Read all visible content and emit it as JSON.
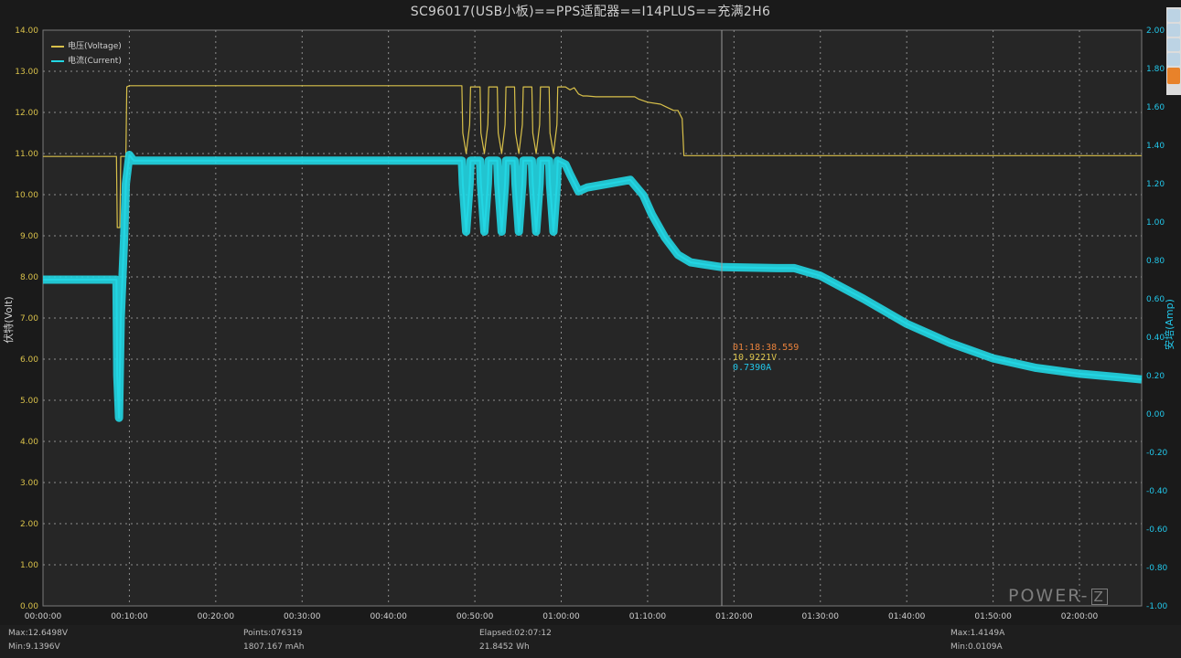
{
  "title": "SC96017(USB小板)==PPS适配器==I14PLUS==充满2H6",
  "colors": {
    "voltage": "#d8c04a",
    "current": "#22d6e3",
    "cursor_time": "#e9823c",
    "cursor_v": "#d8c04a",
    "cursor_a": "#22c7ea",
    "grid": "#8d8d8d",
    "bg": "#1a1a1a"
  },
  "legend": {
    "voltage": "电压(Voltage)",
    "current": "电流(Current)"
  },
  "cursor": {
    "time": "01:18:38.559",
    "voltage": "10.9221V",
    "current": "0.7390A"
  },
  "footer": {
    "max_v": "Max:12.6498V",
    "min_v": "Min:9.1396V",
    "points": "Points:076319",
    "mah": "1807.167 mAh",
    "elapsed": "Elapsed:02:07:12",
    "wh": "21.8452 Wh",
    "max_a": "Max:1.4149A",
    "min_a": "Min:0.0109A"
  },
  "logo": {
    "text": "POWER-",
    "box": "Z"
  },
  "chart_data": {
    "type": "line",
    "ylabel": "伏特(Volt)",
    "y2label": "安培(Amp)",
    "ylim": [
      0,
      14
    ],
    "y2lim": [
      -1.0,
      2.0
    ],
    "x_tick_labels": [
      "00:00:00",
      "00:10:00",
      "00:20:00",
      "00:30:00",
      "00:40:00",
      "00:50:00",
      "01:00:00",
      "01:10:00",
      "01:20:00",
      "01:30:00",
      "01:40:00",
      "01:50:00",
      "02:00:00"
    ],
    "y_tick_labels": [
      "0.00",
      "1.00",
      "2.00",
      "3.00",
      "4.00",
      "5.00",
      "6.00",
      "7.00",
      "8.00",
      "9.00",
      "10.00",
      "11.00",
      "12.00",
      "13.00",
      "14.00"
    ],
    "y2_tick_labels": [
      "-1.00",
      "-0.80",
      "-0.60",
      "-0.40",
      "-0.20",
      "0.00",
      "0.20",
      "0.40",
      "0.60",
      "0.80",
      "1.00",
      "1.20",
      "1.40",
      "1.60",
      "1.80",
      "2.00"
    ],
    "x_unit": "minutes",
    "xlim": [
      0,
      127.2
    ],
    "series": [
      {
        "name": "电压(Voltage)",
        "axis": "left",
        "x": [
          0,
          8.5,
          8.6,
          8.9,
          9.0,
          9.6,
          9.7,
          10.0,
          48.5,
          48.6,
          49.0,
          49.4,
          49.5,
          50.6,
          50.7,
          51.1,
          51.5,
          51.6,
          52.6,
          52.7,
          53.1,
          53.5,
          53.6,
          54.6,
          54.7,
          55.1,
          55.5,
          55.6,
          56.6,
          56.7,
          57.1,
          57.5,
          57.6,
          58.6,
          58.7,
          59.1,
          59.5,
          59.6,
          60.5,
          61.0,
          61.5,
          62.0,
          62.5,
          63.0,
          64.0,
          68.5,
          69.0,
          70.0,
          71.5,
          72.0,
          73.0,
          73.5,
          74.0,
          74.2,
          127.2
        ],
        "y": [
          10.93,
          10.93,
          9.2,
          9.2,
          10.93,
          10.93,
          12.62,
          12.65,
          12.65,
          11.5,
          11.0,
          11.7,
          12.62,
          12.62,
          11.5,
          11.0,
          11.7,
          12.62,
          12.62,
          11.5,
          11.0,
          11.7,
          12.62,
          12.62,
          11.5,
          11.0,
          11.7,
          12.62,
          12.62,
          11.5,
          11.0,
          11.7,
          12.62,
          12.62,
          11.5,
          11.0,
          11.7,
          12.62,
          12.62,
          12.55,
          12.6,
          12.45,
          12.4,
          12.4,
          12.38,
          12.38,
          12.32,
          12.25,
          12.2,
          12.15,
          12.05,
          12.05,
          11.85,
          10.95,
          10.95
        ]
      },
      {
        "name": "电流(Current)",
        "axis": "right",
        "x": [
          0,
          8.5,
          8.6,
          8.8,
          9.0,
          9.4,
          9.6,
          10.0,
          10.5,
          48.5,
          48.6,
          49.0,
          49.4,
          49.5,
          50.6,
          50.7,
          51.1,
          51.5,
          51.6,
          52.6,
          52.7,
          53.1,
          53.5,
          53.6,
          54.6,
          54.7,
          55.1,
          55.5,
          55.6,
          56.6,
          56.7,
          57.1,
          57.5,
          57.6,
          58.6,
          58.7,
          59.1,
          59.5,
          59.6,
          60.5,
          61.0,
          62.0,
          63.0,
          68.0,
          69.5,
          70.5,
          72.0,
          73.5,
          75.0,
          78.6,
          85.0,
          87.0,
          90.0,
          95.0,
          100.0,
          105.0,
          110.0,
          115.0,
          120.0,
          125.0,
          127.2
        ],
        "y": [
          0.7,
          0.7,
          0.2,
          -0.02,
          0.5,
          0.93,
          1.2,
          1.35,
          1.32,
          1.32,
          1.2,
          0.95,
          1.2,
          1.32,
          1.32,
          1.2,
          0.95,
          1.2,
          1.32,
          1.32,
          1.2,
          0.95,
          1.2,
          1.32,
          1.32,
          1.2,
          0.95,
          1.2,
          1.32,
          1.32,
          1.2,
          0.95,
          1.2,
          1.32,
          1.32,
          1.2,
          0.95,
          1.2,
          1.32,
          1.3,
          1.25,
          1.16,
          1.18,
          1.22,
          1.14,
          1.04,
          0.92,
          0.83,
          0.79,
          0.765,
          0.76,
          0.76,
          0.72,
          0.6,
          0.47,
          0.37,
          0.29,
          0.24,
          0.21,
          0.19,
          0.18
        ]
      }
    ]
  }
}
